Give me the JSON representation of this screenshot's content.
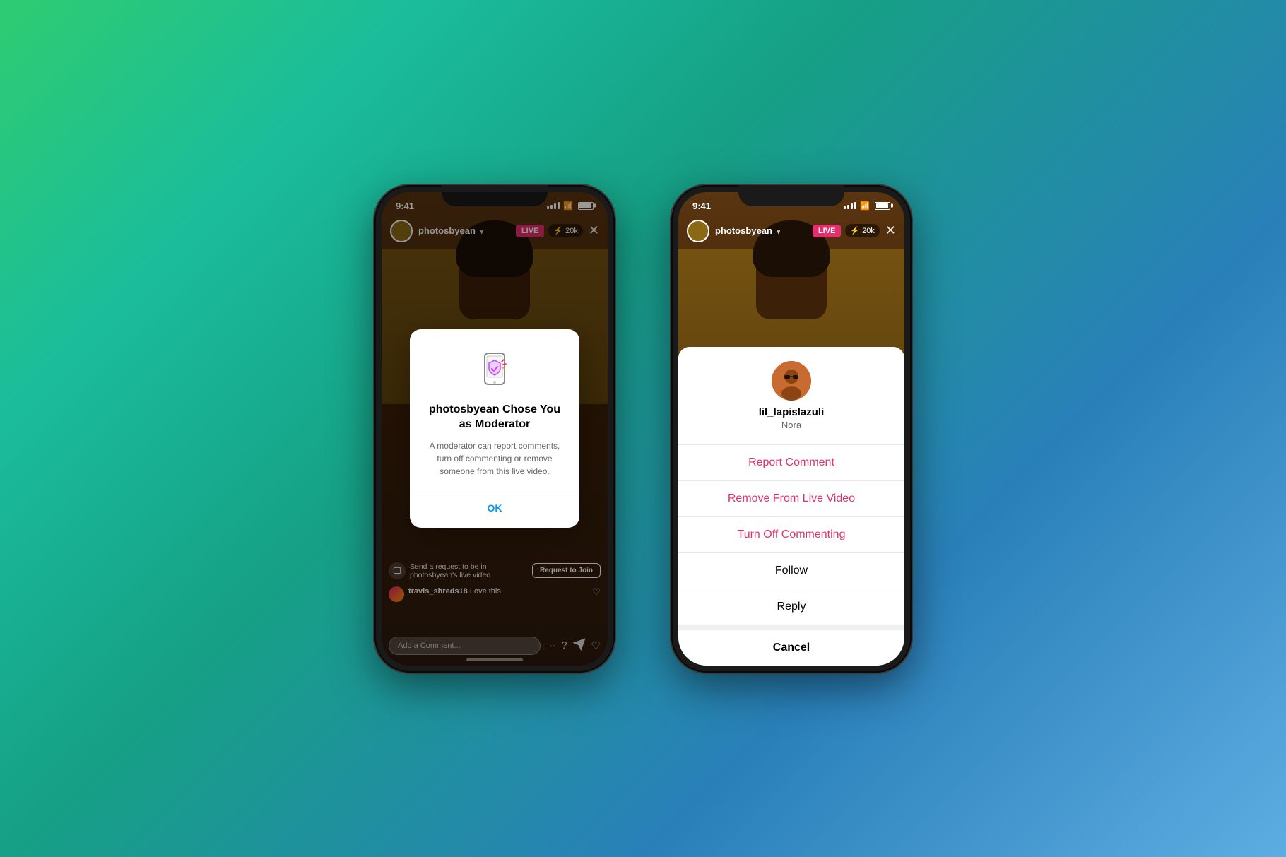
{
  "background": {
    "gradient_start": "#2ecc71",
    "gradient_end": "#5dade2"
  },
  "phone1": {
    "status_bar": {
      "time": "9:41",
      "battery_label": "battery"
    },
    "header": {
      "username": "photosbyean",
      "live_label": "LIVE",
      "viewers": "⚡ 20k",
      "close_symbol": "✕"
    },
    "modal": {
      "title": "photosbyean Chose You as Moderator",
      "description": "A moderator can report comments, turn off commenting or remove someone from this live video.",
      "ok_label": "OK"
    },
    "comments": [
      {
        "username": "travis_shreds18",
        "text": "Love this."
      }
    ],
    "request": {
      "text": "Send a request to be in photosbyean's live video",
      "button_label": "Request to Join"
    },
    "comment_input": {
      "placeholder": "Add a Comment..."
    }
  },
  "phone2": {
    "status_bar": {
      "time": "9:41",
      "battery_label": "battery"
    },
    "header": {
      "username": "photosbyean",
      "live_label": "LIVE",
      "viewers": "⚡ 20k",
      "close_symbol": "✕"
    },
    "action_sheet": {
      "username": "lil_lapislazuli",
      "subname": "Nora",
      "items": [
        {
          "label": "Report Comment",
          "color": "red"
        },
        {
          "label": "Remove From Live Video",
          "color": "red"
        },
        {
          "label": "Turn Off Commenting",
          "color": "red"
        },
        {
          "label": "Follow",
          "color": "black"
        },
        {
          "label": "Reply",
          "color": "black"
        }
      ],
      "cancel_label": "Cancel"
    }
  }
}
